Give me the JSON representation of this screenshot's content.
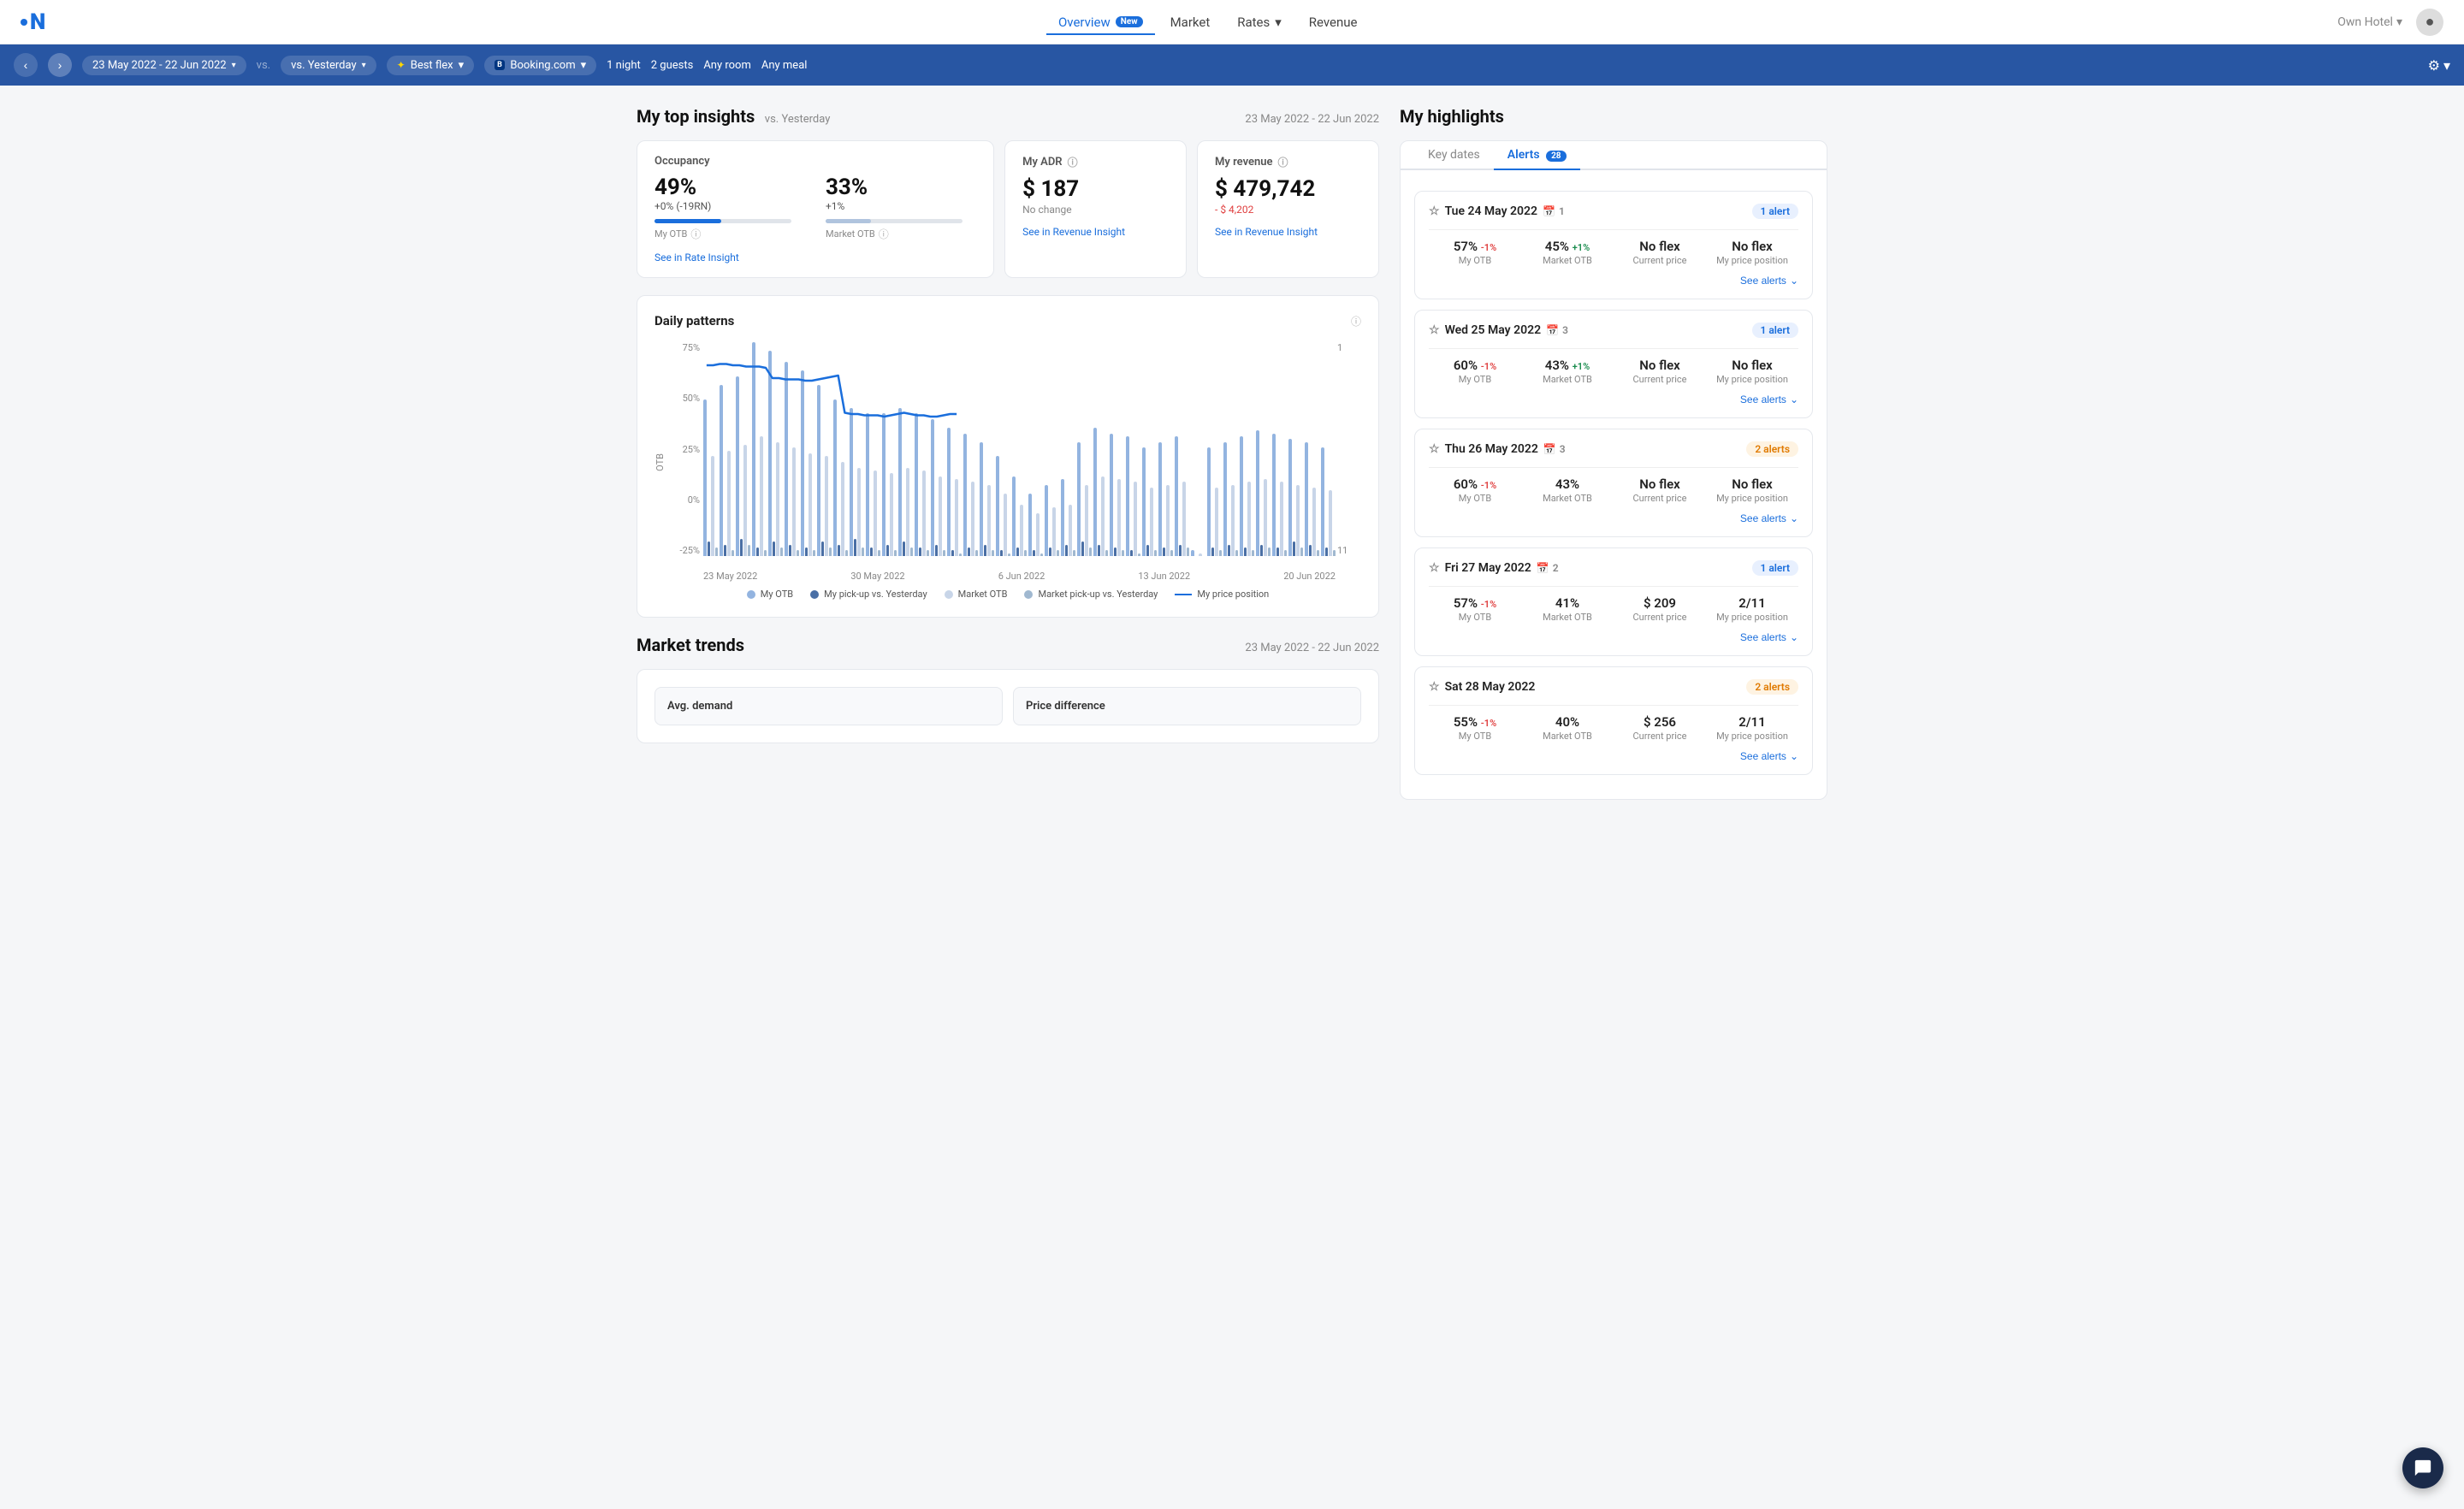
{
  "logo": {
    "letter": "N"
  },
  "nav": {
    "links": [
      {
        "label": "Overview",
        "active": true
      },
      {
        "label": "New",
        "badge": true
      },
      {
        "label": "Market",
        "active": false
      },
      {
        "label": "Rates",
        "active": false,
        "dropdown": true
      },
      {
        "label": "Revenue",
        "active": false
      }
    ],
    "hotel_selector": "Own Hotel",
    "hotel_caret": "▾"
  },
  "subnav": {
    "date_range": "23 May 2022 - 22 Jun 2022",
    "comparison": "vs. Yesterday",
    "flex_label": "Best flex",
    "booking_label": "Booking.com",
    "stay_duration": "1 night",
    "guests": "2 guests",
    "room": "Any room",
    "meal": "Any meal"
  },
  "insights": {
    "title": "My top insights",
    "subtitle": "vs. Yesterday",
    "date_range": "23 May 2022 - 22 Jun 2022",
    "occupancy": {
      "title": "Occupancy",
      "my_pct": "49%",
      "my_change": "+0% (-19RN)",
      "my_bar_pct": 49,
      "my_label": "My OTB",
      "market_pct": "33%",
      "market_change": "+1%",
      "market_bar_pct": 33,
      "market_label": "Market OTB",
      "see_insight": "See in Rate Insight"
    },
    "adr": {
      "title": "My ADR",
      "value": "$ 187",
      "change": "No change",
      "see_insight": "See in Revenue Insight"
    },
    "revenue": {
      "title": "My revenue",
      "value": "$ 479,742",
      "change": "- $ 4,202",
      "see_insight": "See in Revenue Insight"
    }
  },
  "daily_patterns": {
    "title": "Daily patterns",
    "info": "ⓘ",
    "y_label": "OTB",
    "y_right_label": "My price position",
    "y_ticks": [
      "75%",
      "50%",
      "25%",
      "0%",
      "-25%"
    ],
    "y_right_ticks": [
      "1",
      "",
      "",
      "",
      "",
      "11"
    ],
    "x_ticks": [
      "23 May 2022",
      "30 May 2022",
      "6 Jun 2022",
      "13 Jun 2022",
      "20 Jun 2022"
    ],
    "legend": [
      {
        "type": "dot",
        "color": "#93b4e0",
        "label": "My OTB"
      },
      {
        "type": "dot",
        "color": "#4a6fa5",
        "label": "My pick-up vs. Yesterday"
      },
      {
        "type": "dot",
        "color": "#c8d5e8",
        "label": "Market OTB"
      },
      {
        "type": "dot",
        "color": "#a0b8d0",
        "label": "Market pick-up vs. Yesterday"
      },
      {
        "type": "line",
        "color": "#1a6edc",
        "label": "My price position"
      }
    ],
    "bars": [
      {
        "myotb": 55,
        "pickup": 5,
        "marketotb": 35,
        "mktpickup": 3
      },
      {
        "myotb": 60,
        "pickup": 4,
        "marketotb": 37,
        "mktpickup": 2
      },
      {
        "myotb": 63,
        "pickup": 6,
        "marketotb": 39,
        "mktpickup": 4
      },
      {
        "myotb": 75,
        "pickup": 3,
        "marketotb": 42,
        "mktpickup": 2
      },
      {
        "myotb": 72,
        "pickup": 5,
        "marketotb": 40,
        "mktpickup": 3
      },
      {
        "myotb": 68,
        "pickup": 4,
        "marketotb": 38,
        "mktpickup": 2
      },
      {
        "myotb": 65,
        "pickup": 3,
        "marketotb": 36,
        "mktpickup": 2
      },
      {
        "myotb": 60,
        "pickup": 5,
        "marketotb": 35,
        "mktpickup": 3
      },
      {
        "myotb": 55,
        "pickup": 4,
        "marketotb": 33,
        "mktpickup": 2
      },
      {
        "myotb": 52,
        "pickup": 6,
        "marketotb": 31,
        "mktpickup": 3
      },
      {
        "myotb": 50,
        "pickup": 3,
        "marketotb": 30,
        "mktpickup": 2
      },
      {
        "myotb": 50,
        "pickup": 4,
        "marketotb": 29,
        "mktpickup": 2
      },
      {
        "myotb": 52,
        "pickup": 5,
        "marketotb": 31,
        "mktpickup": 3
      },
      {
        "myotb": 50,
        "pickup": 3,
        "marketotb": 30,
        "mktpickup": 2
      },
      {
        "myotb": 48,
        "pickup": 4,
        "marketotb": 28,
        "mktpickup": 2
      },
      {
        "myotb": 45,
        "pickup": 2,
        "marketotb": 27,
        "mktpickup": 1
      },
      {
        "myotb": 43,
        "pickup": 3,
        "marketotb": 26,
        "mktpickup": 2
      },
      {
        "myotb": 40,
        "pickup": 4,
        "marketotb": 25,
        "mktpickup": 2
      },
      {
        "myotb": 35,
        "pickup": 2,
        "marketotb": 22,
        "mktpickup": 1
      },
      {
        "myotb": 28,
        "pickup": 3,
        "marketotb": 18,
        "mktpickup": 2
      },
      {
        "myotb": 22,
        "pickup": 2,
        "marketotb": 15,
        "mktpickup": 1
      },
      {
        "myotb": 25,
        "pickup": 3,
        "marketotb": 17,
        "mktpickup": 2
      },
      {
        "myotb": 27,
        "pickup": 4,
        "marketotb": 18,
        "mktpickup": 2
      },
      {
        "myotb": 40,
        "pickup": 5,
        "marketotb": 25,
        "mktpickup": 3
      },
      {
        "myotb": 45,
        "pickup": 4,
        "marketotb": 28,
        "mktpickup": 2
      },
      {
        "myotb": 43,
        "pickup": 3,
        "marketotb": 27,
        "mktpickup": 2
      },
      {
        "myotb": 42,
        "pickup": 2,
        "marketotb": 26,
        "mktpickup": 1
      },
      {
        "myotb": 38,
        "pickup": 4,
        "marketotb": 24,
        "mktpickup": 2
      },
      {
        "myotb": 40,
        "pickup": 3,
        "marketotb": 25,
        "mktpickup": 2
      },
      {
        "myotb": 42,
        "pickup": 4,
        "marketotb": 26,
        "mktpickup": 3
      },
      {
        "myotb": 2,
        "pickup": 0,
        "marketotb": 1,
        "mktpickup": 0
      },
      {
        "myotb": 38,
        "pickup": 3,
        "marketotb": 24,
        "mktpickup": 2
      },
      {
        "myotb": 40,
        "pickup": 4,
        "marketotb": 25,
        "mktpickup": 2
      },
      {
        "myotb": 42,
        "pickup": 3,
        "marketotb": 26,
        "mktpickup": 2
      },
      {
        "myotb": 44,
        "pickup": 4,
        "marketotb": 27,
        "mktpickup": 3
      },
      {
        "myotb": 43,
        "pickup": 3,
        "marketotb": 26,
        "mktpickup": 2
      },
      {
        "myotb": 41,
        "pickup": 5,
        "marketotb": 25,
        "mktpickup": 3
      },
      {
        "myotb": 40,
        "pickup": 4,
        "marketotb": 24,
        "mktpickup": 2
      },
      {
        "myotb": 38,
        "pickup": 3,
        "marketotb": 23,
        "mktpickup": 2
      }
    ]
  },
  "market_trends": {
    "title": "Market trends",
    "date_range": "23 May 2022 - 22 Jun 2022",
    "cards": [
      {
        "title": "Avg. demand"
      },
      {
        "title": "Price difference"
      }
    ]
  },
  "highlights": {
    "title": "My highlights",
    "tabs": [
      {
        "label": "Key dates",
        "active": false
      },
      {
        "label": "Alerts",
        "active": true,
        "count": 28
      }
    ],
    "alerts": [
      {
        "date": "Tue 24 May 2022",
        "cal_count": 1,
        "badge_label": "1 alert",
        "badge_type": "one",
        "metrics": [
          {
            "value": "57%",
            "change": "-1%",
            "change_type": "neg",
            "label": "My OTB"
          },
          {
            "value": "45%",
            "change": "+1%",
            "change_type": "pos",
            "label": "Market OTB"
          },
          {
            "value": "No flex",
            "change": null,
            "change_type": null,
            "label": "Current price"
          },
          {
            "value": "No flex",
            "change": null,
            "change_type": null,
            "label": "My price position"
          }
        ],
        "see_alerts": "See alerts"
      },
      {
        "date": "Wed 25 May 2022",
        "cal_count": 3,
        "badge_label": "1 alert",
        "badge_type": "one",
        "metrics": [
          {
            "value": "60%",
            "change": "-1%",
            "change_type": "neg",
            "label": "My OTB"
          },
          {
            "value": "43%",
            "change": "+1%",
            "change_type": "pos",
            "label": "Market OTB"
          },
          {
            "value": "No flex",
            "change": null,
            "change_type": null,
            "label": "Current price"
          },
          {
            "value": "No flex",
            "change": null,
            "change_type": null,
            "label": "My price position"
          }
        ],
        "see_alerts": "See alerts"
      },
      {
        "date": "Thu 26 May 2022",
        "cal_count": 3,
        "badge_label": "2 alerts",
        "badge_type": "two",
        "metrics": [
          {
            "value": "60%",
            "change": "-1%",
            "change_type": "neg",
            "label": "My OTB"
          },
          {
            "value": "43%",
            "change": null,
            "change_type": null,
            "label": "Market OTB"
          },
          {
            "value": "No flex",
            "change": null,
            "change_type": null,
            "label": "Current price"
          },
          {
            "value": "No flex",
            "change": null,
            "change_type": null,
            "label": "My price position"
          }
        ],
        "see_alerts": "See alerts"
      },
      {
        "date": "Fri 27 May 2022",
        "cal_count": 2,
        "badge_label": "1 alert",
        "badge_type": "one",
        "metrics": [
          {
            "value": "57%",
            "change": "-1%",
            "change_type": "neg",
            "label": "My OTB"
          },
          {
            "value": "41%",
            "change": null,
            "change_type": null,
            "label": "Market OTB"
          },
          {
            "value": "$ 209",
            "change": null,
            "change_type": null,
            "label": "Current price"
          },
          {
            "value": "2/11",
            "change": null,
            "change_type": null,
            "label": "My price position"
          }
        ],
        "see_alerts": "See alerts"
      },
      {
        "date": "Sat 28 May 2022",
        "cal_count": null,
        "badge_label": "2 alerts",
        "badge_type": "two",
        "metrics": [
          {
            "value": "55%",
            "change": "-1%",
            "change_type": "neg",
            "label": "My OTB"
          },
          {
            "value": "40%",
            "change": null,
            "change_type": null,
            "label": "Market OTB"
          },
          {
            "value": "$ 256",
            "change": null,
            "change_type": null,
            "label": "Current price"
          },
          {
            "value": "2/11",
            "change": null,
            "change_type": null,
            "label": "My price position"
          }
        ],
        "see_alerts": "See alerts"
      }
    ]
  },
  "chat": {
    "label": "Chat"
  }
}
